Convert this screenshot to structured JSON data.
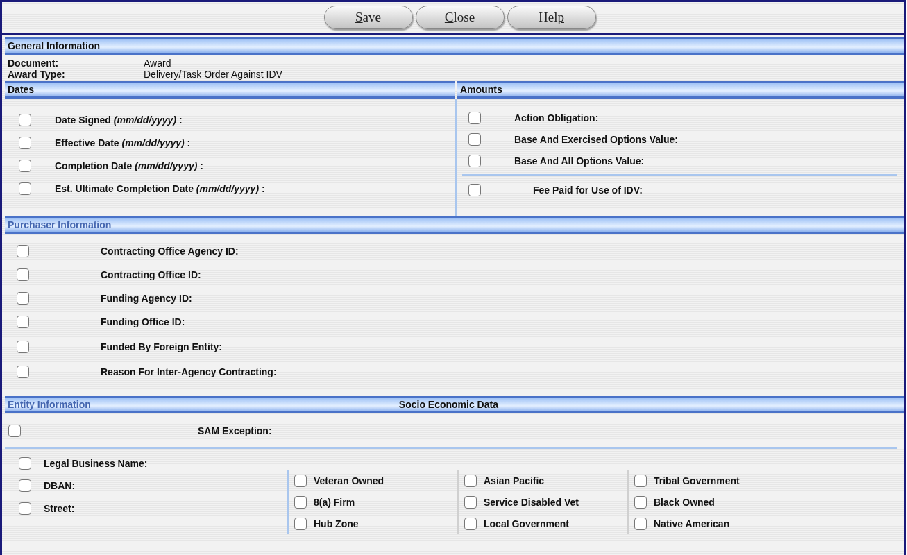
{
  "toolbar": {
    "buttons": [
      {
        "accesskey": "S",
        "rest": "ave"
      },
      {
        "accesskey": "C",
        "rest": "lose"
      },
      {
        "lead": "Hel",
        "accesskey": "p"
      }
    ]
  },
  "general": {
    "title": "General Information",
    "dimmed": false,
    "rows": [
      {
        "label": "Document:",
        "value": "Award"
      },
      {
        "label": "Award Type:",
        "value": "Delivery/Task Order Against IDV"
      }
    ]
  },
  "dates": {
    "title": "Dates",
    "dimmed": false,
    "fields": [
      {
        "label": "Date Signed *(mm/dd/yyyy)* :",
        "checked": false
      },
      {
        "label": "Effective Date *(mm/dd/yyyy)* :",
        "checked": false
      },
      {
        "label": "Completion Date *(mm/dd/yyyy)* :",
        "checked": false
      },
      {
        "label": "Est. Ultimate Completion Date *(mm/dd/yyyy)* :",
        "checked": false
      }
    ]
  },
  "amounts": {
    "title": "Amounts",
    "dimmed": false,
    "fields": [
      {
        "label": "Action Obligation:",
        "checked": false
      },
      {
        "label": "Base And Exercised Options Value:",
        "checked": false
      },
      {
        "label": "Base And All Options Value:",
        "checked": false
      }
    ],
    "fee": {
      "label": "Fee Paid for Use of IDV:",
      "checked": false
    }
  },
  "purchaser": {
    "title": "Purchaser Information",
    "dimmed": true,
    "fields": [
      {
        "label": "Contracting Office Agency ID:",
        "checked": false
      },
      {
        "label": "Contracting Office ID:",
        "checked": false
      },
      {
        "label": "Funding Agency ID:",
        "checked": false
      },
      {
        "label": "Funding Office ID:",
        "checked": false
      },
      {
        "label": "Funded By Foreign Entity:",
        "checked": false
      },
      {
        "label": "Reason For Inter-Agency Contracting:",
        "checked": false
      }
    ]
  },
  "entity": {
    "title": "Entity Information",
    "dimmed": true,
    "subtitle": "Socio Economic Data",
    "sam": {
      "label": "SAM Exception:",
      "checked": false
    },
    "fields": [
      {
        "label": "Legal Business Name:",
        "checked": false
      },
      {
        "label": "DBAN:",
        "checked": false
      },
      {
        "label": "Street:",
        "checked": false
      }
    ],
    "socio_columns": [
      [
        {
          "label": "Veteran Owned",
          "checked": false
        },
        {
          "label": "8(a) Firm",
          "checked": false
        },
        {
          "label": "Hub Zone",
          "checked": false
        }
      ],
      [
        {
          "label": "Asian Pacific",
          "checked": false
        },
        {
          "label": "Service Disabled Vet",
          "checked": false
        },
        {
          "label": "Local Government",
          "checked": false
        }
      ],
      [
        {
          "label": "Tribal Government",
          "checked": false
        },
        {
          "label": "Black Owned",
          "checked": false
        },
        {
          "label": "Native American",
          "checked": false
        }
      ]
    ]
  }
}
